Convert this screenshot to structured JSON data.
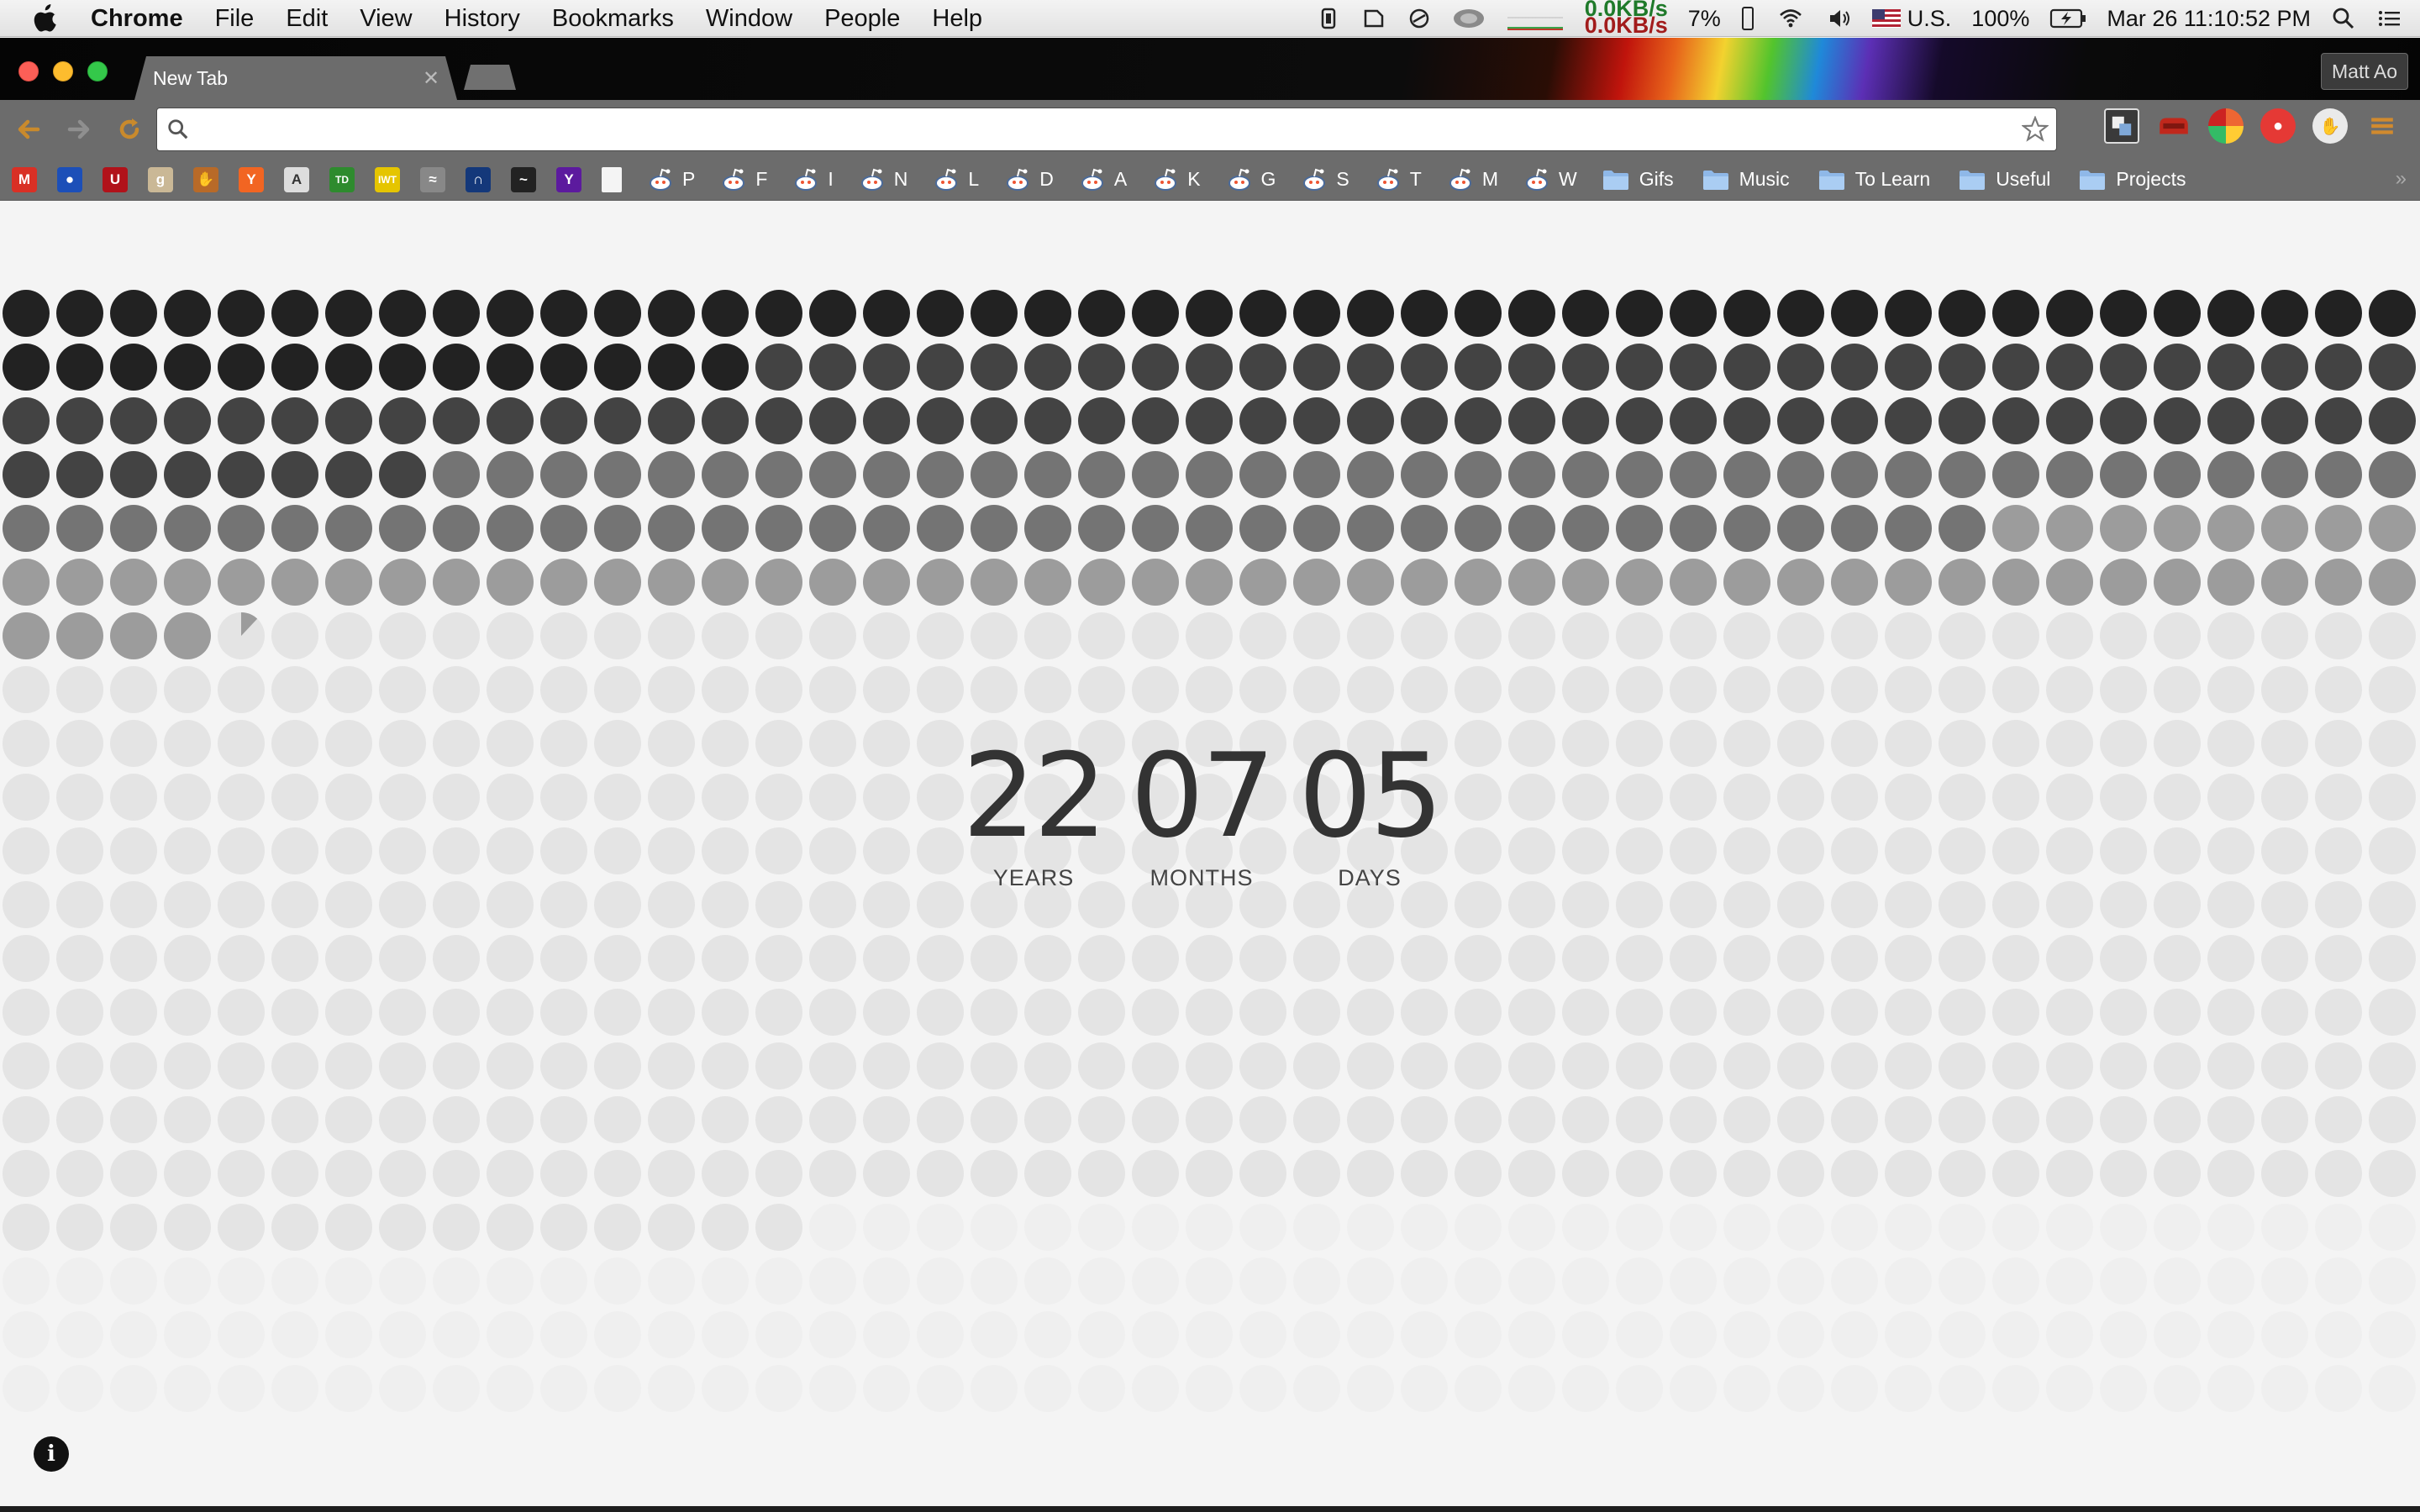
{
  "menubar": {
    "app_name": "Chrome",
    "items": [
      "File",
      "Edit",
      "View",
      "History",
      "Bookmarks",
      "Window",
      "People",
      "Help"
    ],
    "netspeed_up": "0.0KB/s",
    "netspeed_down": "0.0KB/s",
    "cpu": "7%",
    "input_source": "U.S.",
    "battery": "100%",
    "clock": "Mar 26  11:10:52 PM",
    "icons": [
      "apple-icon",
      "app-status-icon",
      "drive-icon",
      "sync-icon",
      "dropbox-icon",
      "graph-icon",
      "wifi-icon",
      "volume-icon",
      "flag-icon",
      "battery-charging-icon",
      "spotlight-search-icon",
      "notification-center-icon"
    ]
  },
  "browser": {
    "tab_title": "New Tab",
    "profile_name": "Matt Ao",
    "omnibox_value": "",
    "omnibox_placeholder": ""
  },
  "bookmarks": {
    "icons": [
      {
        "name": "gmail-bookmark",
        "color": "#d93025",
        "glyph": "M"
      },
      {
        "name": "bookmark-round-logo",
        "color": "#1c4fb8",
        "glyph": "●"
      },
      {
        "name": "u-bookmark",
        "color": "#b1121a",
        "glyph": "U"
      },
      {
        "name": "g-bookmark",
        "color": "#cab896",
        "glyph": "g"
      },
      {
        "name": "hand-bookmark",
        "color": "#b86a28",
        "glyph": "✋"
      },
      {
        "name": "y-combinator-bookmark",
        "color": "#f26522",
        "glyph": "Y"
      },
      {
        "name": "a-to-z-bookmark",
        "color": "#dddddd",
        "glyph": "A"
      },
      {
        "name": "td-bookmark",
        "color": "#2e8b2e",
        "glyph": "TD"
      },
      {
        "name": "iwt-bookmark",
        "color": "#e5c500",
        "glyph": "IWT"
      },
      {
        "name": "wave-bookmark",
        "color": "#888888",
        "glyph": "≈"
      },
      {
        "name": "n-bookmark",
        "color": "#14387a",
        "glyph": "∩"
      },
      {
        "name": "mustache-bookmark",
        "color": "#222222",
        "glyph": "~"
      },
      {
        "name": "yahoo-bookmark",
        "color": "#5c1a9e",
        "glyph": "Y"
      },
      {
        "name": "page-bookmark",
        "color": "#f4f4f4",
        "glyph": ""
      }
    ],
    "reddit_items": [
      "P",
      "F",
      "I",
      "N",
      "L",
      "D",
      "A",
      "K",
      "G",
      "S",
      "T",
      "M",
      "W"
    ],
    "folders": [
      "Gifs",
      "Music",
      "To Learn",
      "Useful",
      "Projects"
    ],
    "overflow": "»"
  },
  "countdown": {
    "years": "22",
    "months": "07",
    "days": "05",
    "years_label": "YEARS",
    "months_label": "MONTHS",
    "days_label": "DAYS"
  },
  "life_grid": {
    "columns": 45,
    "rows": 21,
    "filled_fraction_of_partial_dot": 0.12,
    "tone_colors": [
      "#222222",
      "#434343",
      "#747474",
      "#9c9c9c",
      "#bababa",
      "#e4e4e4",
      "#efefef"
    ]
  },
  "info_icon": "i"
}
